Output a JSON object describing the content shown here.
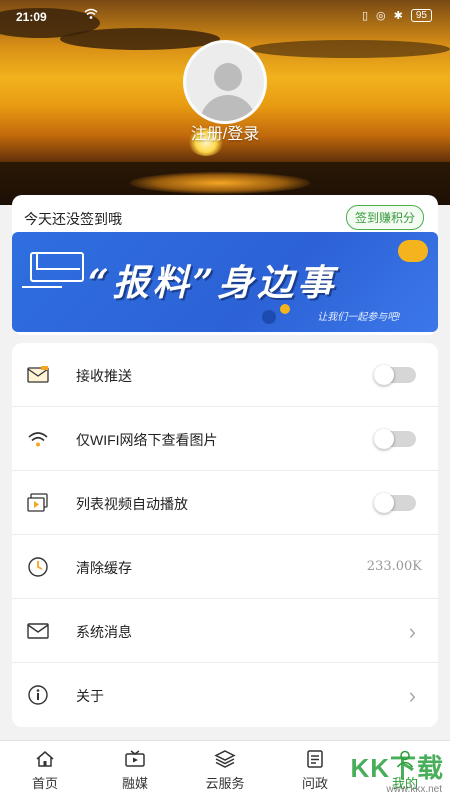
{
  "statusbar": {
    "time": "21:09",
    "battery": "95"
  },
  "profile": {
    "login_label": "注册/登录"
  },
  "signin": {
    "message": "今天还没签到哦",
    "earn_button": "签到赚积分"
  },
  "banner": {
    "title": "“报料”身边事",
    "subtitle": "让我们一起参与吧!"
  },
  "settings": [
    {
      "icon": "envelope-push-icon",
      "label": "接收推送",
      "type": "toggle",
      "on": false
    },
    {
      "icon": "wifi-icon",
      "label": "仅WIFI网络下查看图片",
      "type": "toggle",
      "on": false
    },
    {
      "icon": "video-icon",
      "label": "列表视频自动播放",
      "type": "toggle",
      "on": false
    },
    {
      "icon": "clock-icon",
      "label": "清除缓存",
      "type": "value",
      "value": "233.00K"
    },
    {
      "icon": "mail-icon",
      "label": "系统消息",
      "type": "link"
    },
    {
      "icon": "info-icon",
      "label": "关于",
      "type": "link"
    }
  ],
  "nav": [
    {
      "icon": "home-icon",
      "label": "首页",
      "active": false
    },
    {
      "icon": "media-icon",
      "label": "融媒",
      "active": false
    },
    {
      "icon": "cloud-service-icon",
      "label": "云服务",
      "active": false
    },
    {
      "icon": "politics-icon",
      "label": "问政",
      "active": false
    },
    {
      "icon": "profile-icon",
      "label": "我的",
      "active": true
    }
  ],
  "watermark": {
    "text": "KK下载",
    "url": "www.kkx.net"
  },
  "colors": {
    "accent": "#2e9e3a",
    "banner": "#2f6fe0"
  }
}
